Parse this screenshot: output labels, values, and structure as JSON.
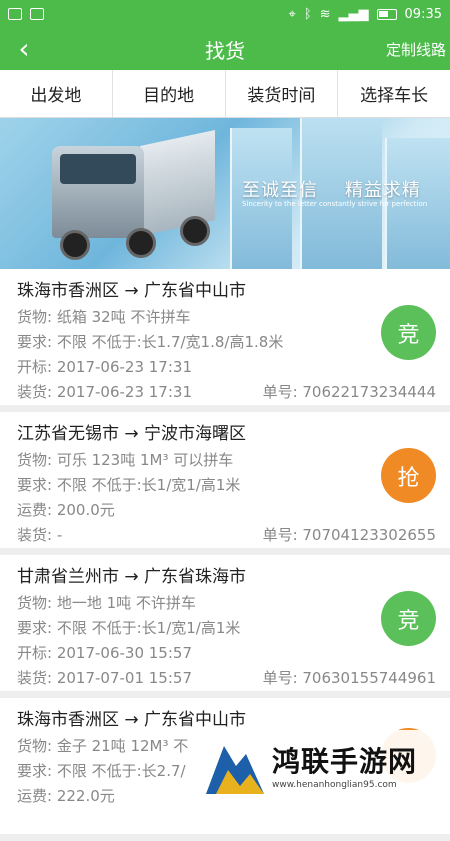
{
  "status_bar": {
    "time": "09:35"
  },
  "nav": {
    "title": "找货",
    "right_label": "定制线路"
  },
  "filters": [
    "出发地",
    "目的地",
    "装货时间",
    "选择车长"
  ],
  "banner": {
    "slogan_1": "至诚至信",
    "slogan_2": "精益求精",
    "subtitle": "Sincerity to the letter constantly strive for perfection"
  },
  "cards": [
    {
      "route": "珠海市香洲区 → 广东省中山市",
      "line1": "货物: 纸箱 32吨 不许拼车",
      "line2": "要求: 不限 不低于:长1.7/宽1.8/高1.8米",
      "line3": "开标: 2017-06-23 17:31",
      "load": "装货: 2017-06-23 17:31",
      "order": "单号: 70622173234444",
      "badge": "竞",
      "badge_color": "#5cc05a"
    },
    {
      "route": "江苏省无锡市 → 宁波市海曙区",
      "line1": "货物: 可乐 123吨 1M³ 可以拼车",
      "line2": "要求: 不限 不低于:长1/宽1/高1米",
      "line3": "运费: 200.0元",
      "load": "装货: -",
      "order": "单号: 70704123302655",
      "badge": "抢",
      "badge_color": "#f08a24"
    },
    {
      "route": "甘肃省兰州市 → 广东省珠海市",
      "line1": "货物: 地一地 1吨 不许拼车",
      "line2": "要求: 不限 不低于:长1/宽1/高1米",
      "line3": "开标: 2017-06-30 15:57",
      "load": "装货: 2017-07-01 15:57",
      "order": "单号: 70630155744961",
      "badge": "竞",
      "badge_color": "#5cc05a"
    },
    {
      "route": "珠海市香洲区 → 广东省中山市",
      "line1": "货物: 金子 21吨 12M³ 不",
      "line2": "要求: 不限 不低于:长2.7/",
      "line3": "运费: 222.0元",
      "load": "",
      "order": "",
      "badge": "",
      "badge_color": "#f08a24"
    }
  ],
  "watermark": {
    "name": "鸿联手游网",
    "url": "www.henanhonglian95.com"
  }
}
